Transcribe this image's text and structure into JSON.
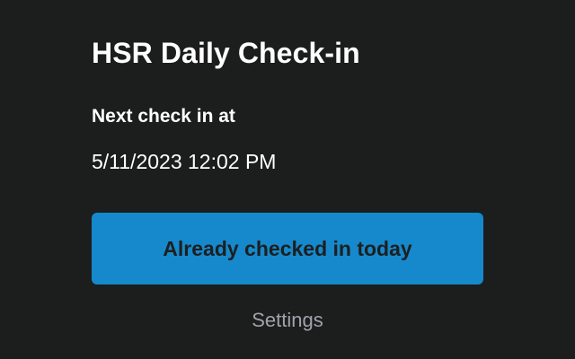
{
  "app": {
    "title": "HSR Daily Check-in"
  },
  "status": {
    "next_label": "Next check in at",
    "next_time": "5/11/2023 12:02 PM"
  },
  "actions": {
    "checkin_button_label": "Already checked in today",
    "settings_label": "Settings"
  },
  "colors": {
    "background": "#1c1d1d",
    "primary_button": "#1589cc",
    "button_text": "#1d1f20",
    "link_text": "#a1a2ad",
    "text": "#ffffff"
  }
}
